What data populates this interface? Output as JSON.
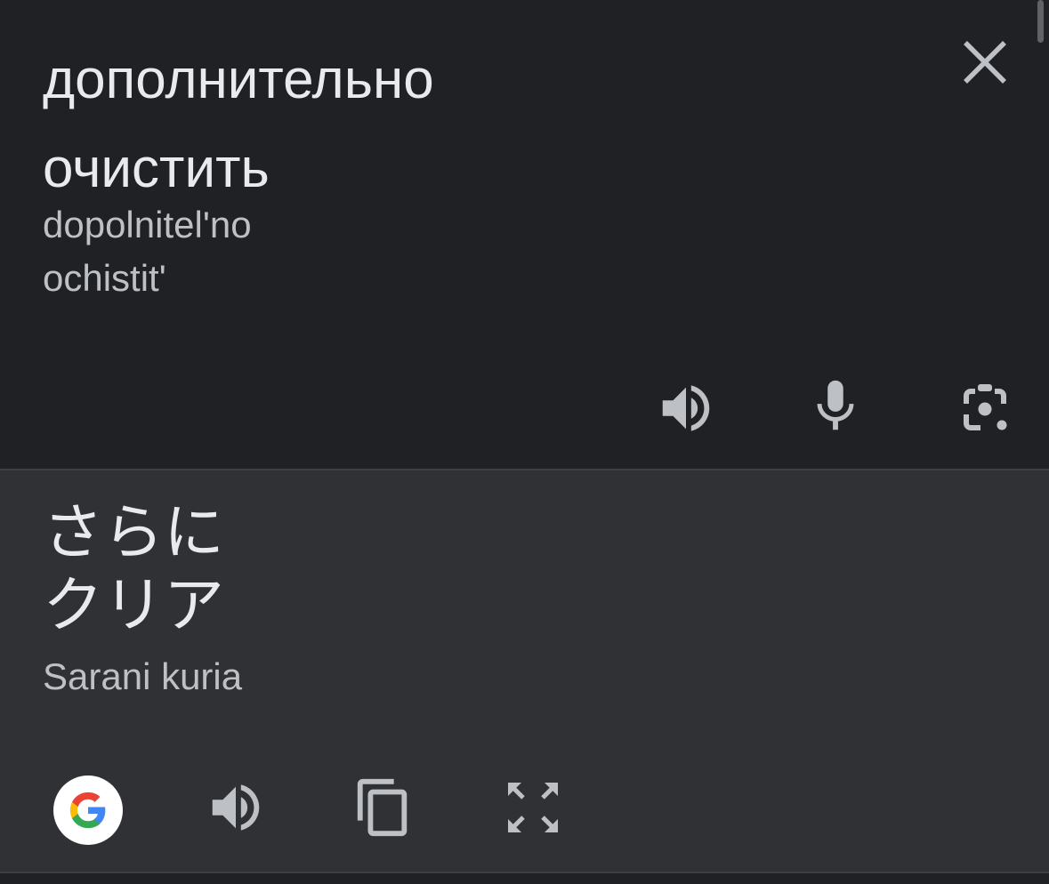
{
  "source": {
    "lines": [
      "дополнительно",
      "очистить"
    ],
    "transliteration": [
      "dopolnitel'no",
      "ochistit'"
    ]
  },
  "target": {
    "lines": [
      "さらに",
      "クリア"
    ],
    "transliteration": "Sarani kuria"
  },
  "icons": {
    "close": "close-icon",
    "source_speaker": "speaker-icon",
    "mic": "microphone-icon",
    "camera": "camera-lens-icon",
    "google": "google-logo-icon",
    "target_speaker": "speaker-icon",
    "copy": "copy-icon",
    "fullscreen": "fullscreen-icon"
  },
  "colors": {
    "source_bg": "#202124",
    "target_bg": "#303134",
    "text_primary": "#e8eaed",
    "text_secondary": "#bdc1c6",
    "icon": "#bdc1c6"
  }
}
